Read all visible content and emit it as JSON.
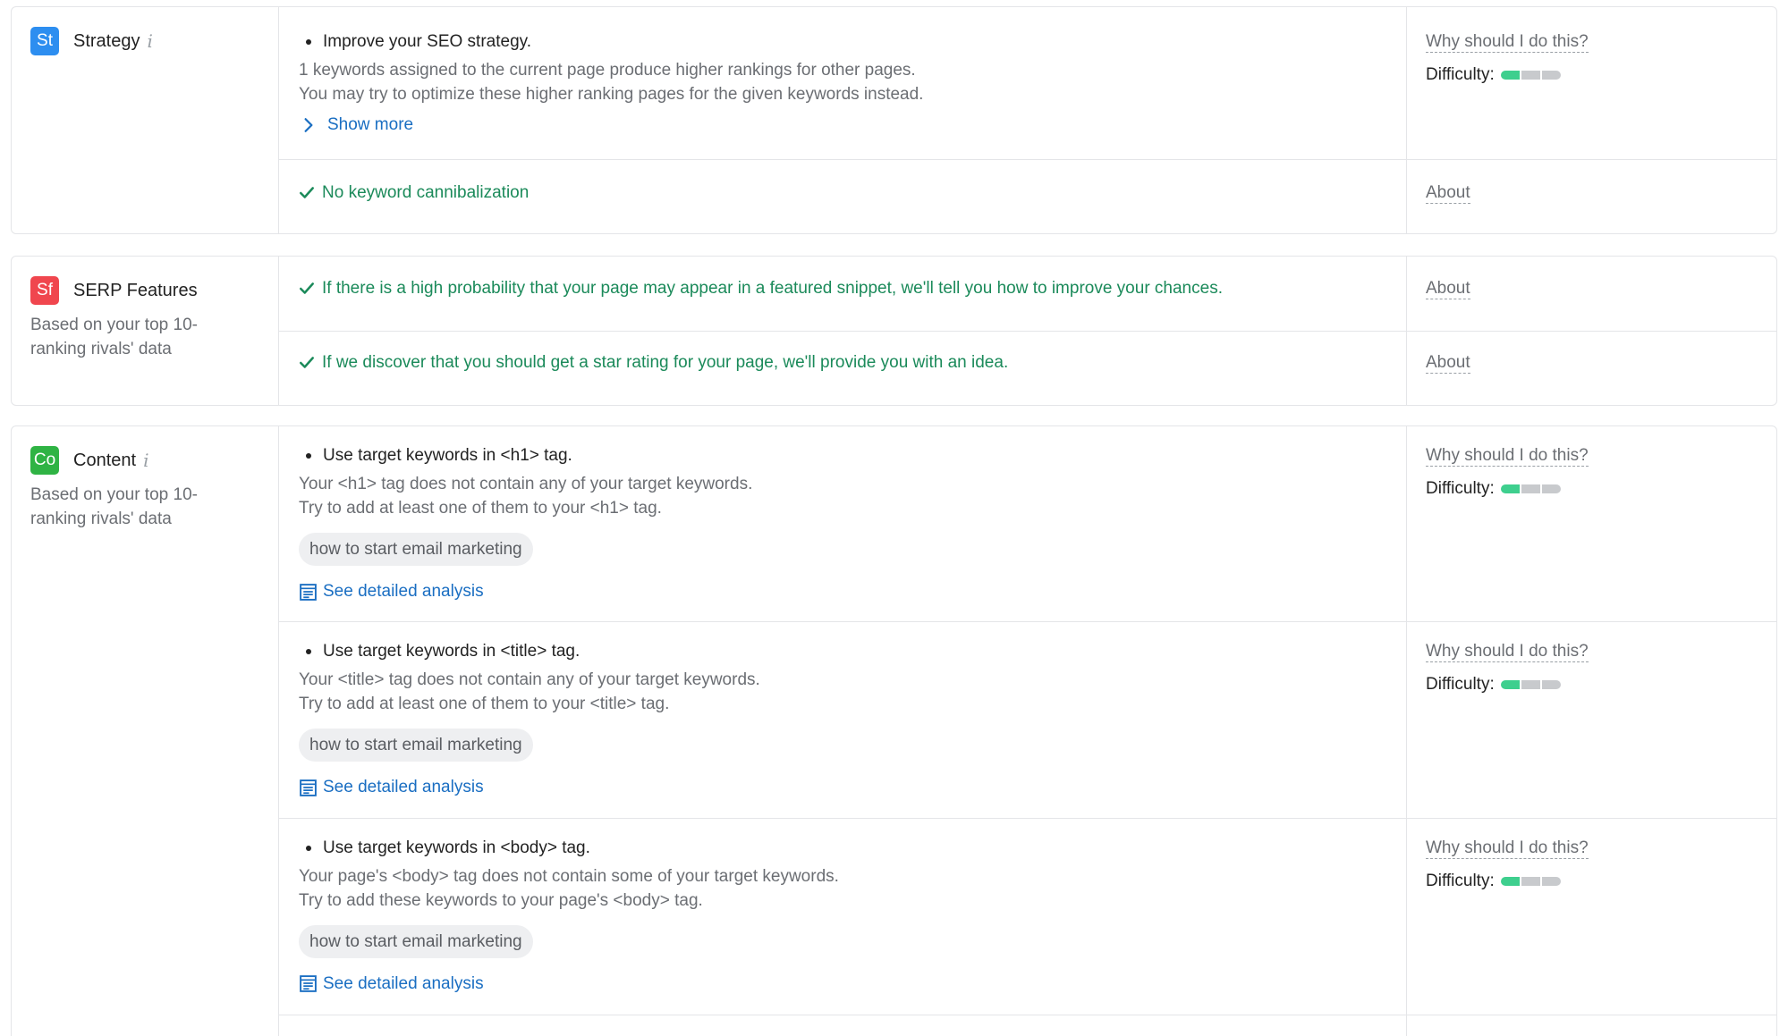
{
  "colors": {
    "strategy_badge": "#2d8ef0",
    "serp_badge": "#f0464e",
    "content_badge": "#2fb344",
    "link": "#1a6ec2",
    "success": "#1b8a5a",
    "difficulty_filled": "#3ecf8e",
    "difficulty_empty": "#c8cacd"
  },
  "strategy": {
    "badge": "St",
    "title": "Strategy",
    "info": "i",
    "rows": [
      {
        "title": "Improve your SEO strategy.",
        "desc1": "1 keywords assigned to the current page produce higher rankings for other pages.",
        "desc2": "You may try to optimize these higher ranking pages for the given keywords instead.",
        "show_more": "Show more",
        "why": "Why should I do this?",
        "difficulty_label": "Difficulty:",
        "difficulty_level": 1,
        "difficulty_max": 3
      },
      {
        "check": "No keyword cannibalization",
        "about": "About"
      }
    ]
  },
  "serp": {
    "badge": "Sf",
    "title": "SERP Features",
    "subtitle": "Based on your top 10-ranking rivals' data",
    "rows": [
      {
        "check": "If there is a high probability that your page may appear in a featured snippet, we'll tell you how to improve your chances.",
        "about": "About"
      },
      {
        "check": "If we discover that you should get a star rating for your page, we'll provide you with an idea.",
        "about": "About"
      }
    ]
  },
  "content": {
    "badge": "Co",
    "title": "Content",
    "info": "i",
    "subtitle": "Based on your top 10-ranking rivals' data",
    "rows": [
      {
        "title": "Use target keywords in <h1> tag.",
        "desc1": "Your <h1> tag does not contain any of your target keywords.",
        "desc2": "Try to add at least one of them to your <h1> tag.",
        "keyword": "how to start email marketing",
        "link": "See detailed analysis",
        "why": "Why should I do this?",
        "difficulty_label": "Difficulty:",
        "difficulty_level": 1,
        "difficulty_max": 3
      },
      {
        "title": "Use target keywords in <title> tag.",
        "desc1": "Your <title> tag does not contain any of your target keywords.",
        "desc2": "Try to add at least one of them to your <title> tag.",
        "keyword": "how to start email marketing",
        "link": "See detailed analysis",
        "why": "Why should I do this?",
        "difficulty_label": "Difficulty:",
        "difficulty_level": 1,
        "difficulty_max": 3
      },
      {
        "title": "Use target keywords in <body> tag.",
        "desc1": "Your page's <body> tag does not contain some of your target keywords.",
        "desc2": "Try to add these keywords to your page's <body> tag.",
        "keyword": "how to start email marketing",
        "link": "See detailed analysis",
        "why": "Why should I do this?",
        "difficulty_label": "Difficulty:",
        "difficulty_level": 1,
        "difficulty_max": 3
      }
    ]
  }
}
